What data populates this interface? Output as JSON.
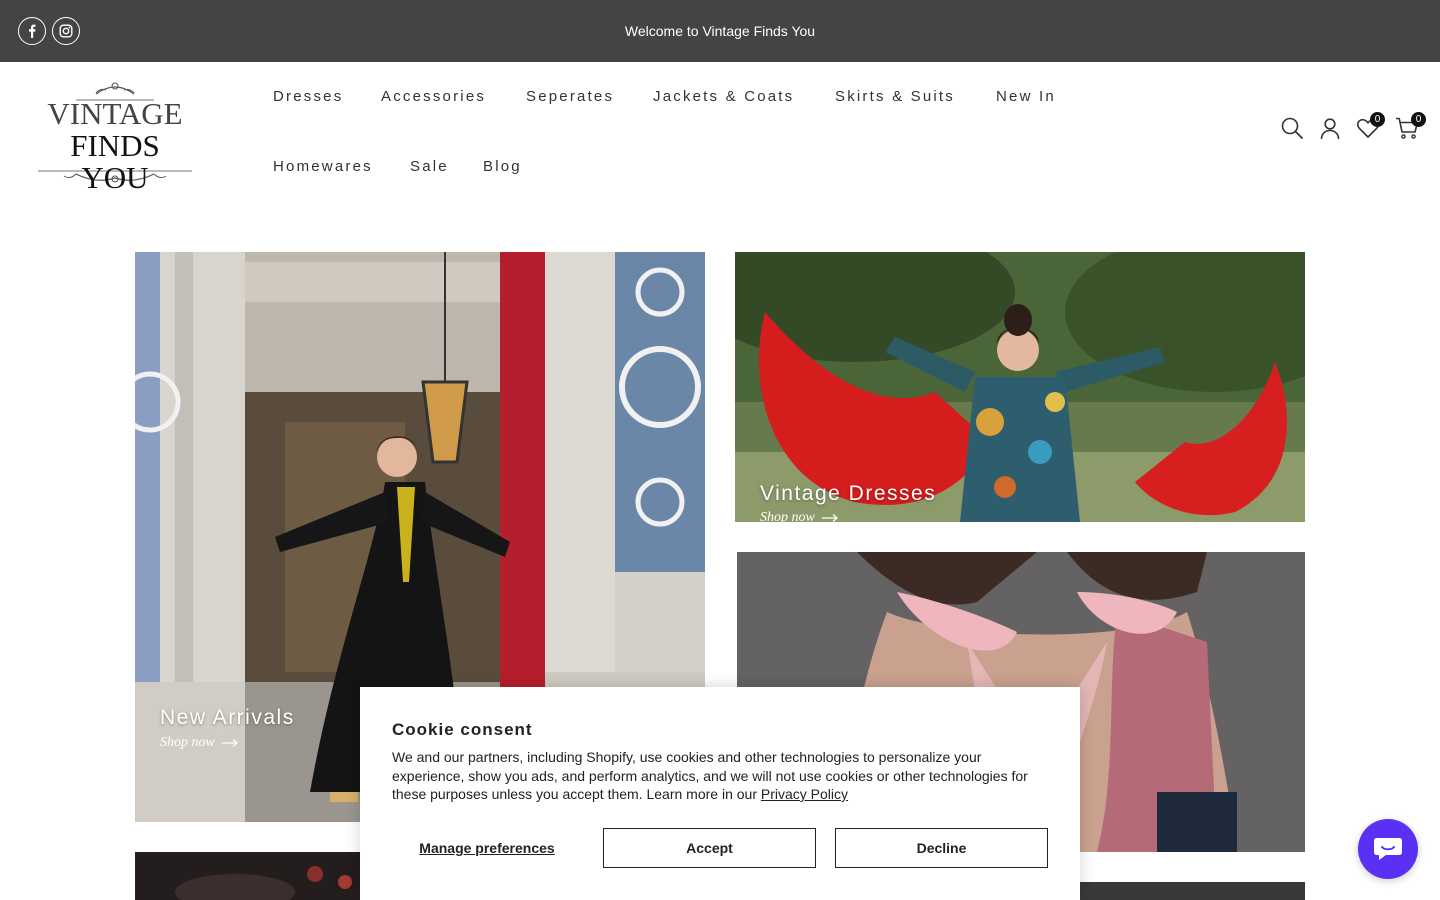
{
  "announcement": {
    "text": "Welcome to Vintage Finds You"
  },
  "social": [
    {
      "name": "facebook-icon",
      "glyph": "f"
    },
    {
      "name": "instagram-icon"
    }
  ],
  "logo": {
    "line1": "VINTAGE",
    "line2": "FINDS YOU"
  },
  "nav": [
    {
      "label": "Dresses"
    },
    {
      "label": "Accessories"
    },
    {
      "label": "Seperates"
    },
    {
      "label": "Jackets & Coats"
    },
    {
      "label": "Skirts & Suits"
    },
    {
      "label": "New In"
    },
    {
      "label": "Homewares"
    },
    {
      "label": "Sale"
    },
    {
      "label": "Blog"
    }
  ],
  "header_icons": {
    "search": "search-icon",
    "account": "user-icon",
    "wishlist": "heart-icon",
    "cart": "cart-icon",
    "wishlist_count": "0",
    "cart_count": "0"
  },
  "banners": [
    {
      "title": "New Arrivals",
      "link": "Shop now"
    },
    {
      "title": "Vintage Dresses",
      "link": "Shop now"
    },
    {
      "title": "",
      "link": ""
    }
  ],
  "cookie": {
    "title": "Cookie consent",
    "body": "We and our partners, including Shopify, use cookies and other technologies to personalize your experience, show you ads, and perform analytics, and we will not use cookies or other technologies for these purposes unless you accept them. Learn more in our ",
    "link": "Privacy Policy",
    "manage": "Manage preferences",
    "accept": "Accept",
    "decline": "Decline"
  },
  "colors": {
    "topbar": "#444444",
    "chat": "#5a31f4"
  }
}
